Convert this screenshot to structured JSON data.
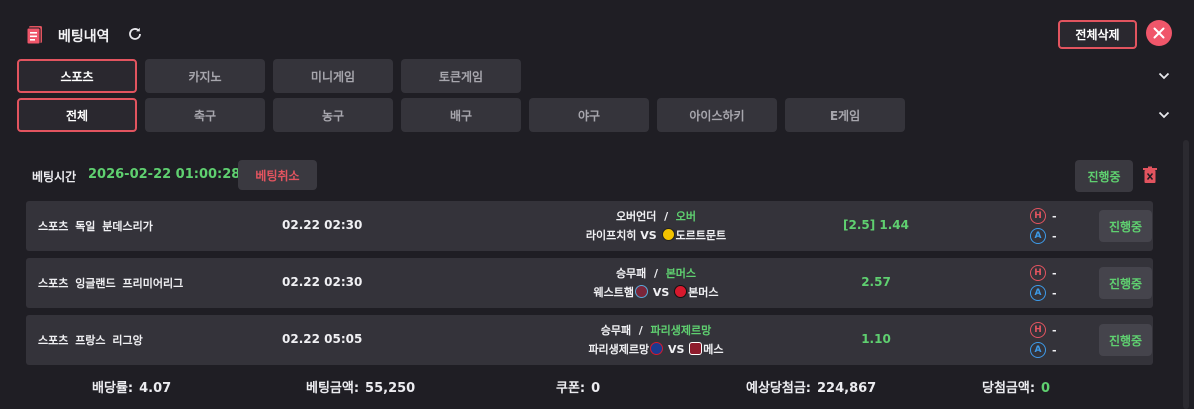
{
  "header": {
    "title": "베팅내역",
    "delete_all_label": "전체삭제"
  },
  "colors": {
    "accent_red": "#e2545f",
    "green": "#5fd070",
    "blue": "#3d9be9",
    "background": "#1f1e24"
  },
  "category_tabs": [
    {
      "label": "스포츠",
      "active": true
    },
    {
      "label": "카지노",
      "active": false
    },
    {
      "label": "미니게임",
      "active": false
    },
    {
      "label": "토큰게임",
      "active": false
    }
  ],
  "sport_tabs": [
    {
      "label": "전체",
      "active": true
    },
    {
      "label": "축구",
      "active": false
    },
    {
      "label": "농구",
      "active": false
    },
    {
      "label": "배구",
      "active": false
    },
    {
      "label": "야구",
      "active": false
    },
    {
      "label": "아이스하키",
      "active": false
    },
    {
      "label": "E게임",
      "active": false
    }
  ],
  "bet": {
    "time_label": "베팅시간",
    "time_value": "2026-02-22 01:00:28",
    "cancel_label": "베팅취소",
    "status_label": "진행중"
  },
  "rows": [
    {
      "league": "스포츠 독일 분데스리가",
      "time": "02.22 02:30",
      "market": "오버언더",
      "separator": "/",
      "selection": "오버",
      "home": "라이프치히",
      "vs": "VS",
      "away": "도르트문트",
      "home_crest": "leipzig-crest-icon",
      "away_crest": "dortmund-crest-icon",
      "odds": "[2.5] 1.44",
      "h_value": "-",
      "a_value": "-",
      "h_label": "H",
      "a_label": "A",
      "status": "진행중"
    },
    {
      "league": "스포츠 잉글랜드 프리미어리그",
      "time": "02.22 02:30",
      "market": "승무패",
      "separator": "/",
      "selection": "본머스",
      "home": "웨스트햄",
      "vs": "VS",
      "away": "본머스",
      "home_crest": "westham-crest-icon",
      "away_crest": "bournemouth-crest-icon",
      "odds": "2.57",
      "h_value": "-",
      "a_value": "-",
      "h_label": "H",
      "a_label": "A",
      "status": "진행중"
    },
    {
      "league": "스포츠 프랑스 리그앙",
      "time": "02.22 05:05",
      "market": "승무패",
      "separator": "/",
      "selection": "파리생제르망",
      "home": "파리생제르망",
      "vs": "VS",
      "away": "메스",
      "home_crest": "psg-crest-icon",
      "away_crest": "metz-crest-icon",
      "odds": "1.10",
      "h_value": "-",
      "a_value": "-",
      "h_label": "H",
      "a_label": "A",
      "status": "진행중"
    }
  ],
  "summary": {
    "odds_label": "배당률:",
    "odds_value": "4.07",
    "amount_label": "베팅금액:",
    "amount_value": "55,250",
    "coupon_label": "쿠폰:",
    "coupon_value": "0",
    "expected_label": "예상당첨금:",
    "expected_value": "224,867",
    "win_label": "당첨금액:",
    "win_value": "0"
  }
}
